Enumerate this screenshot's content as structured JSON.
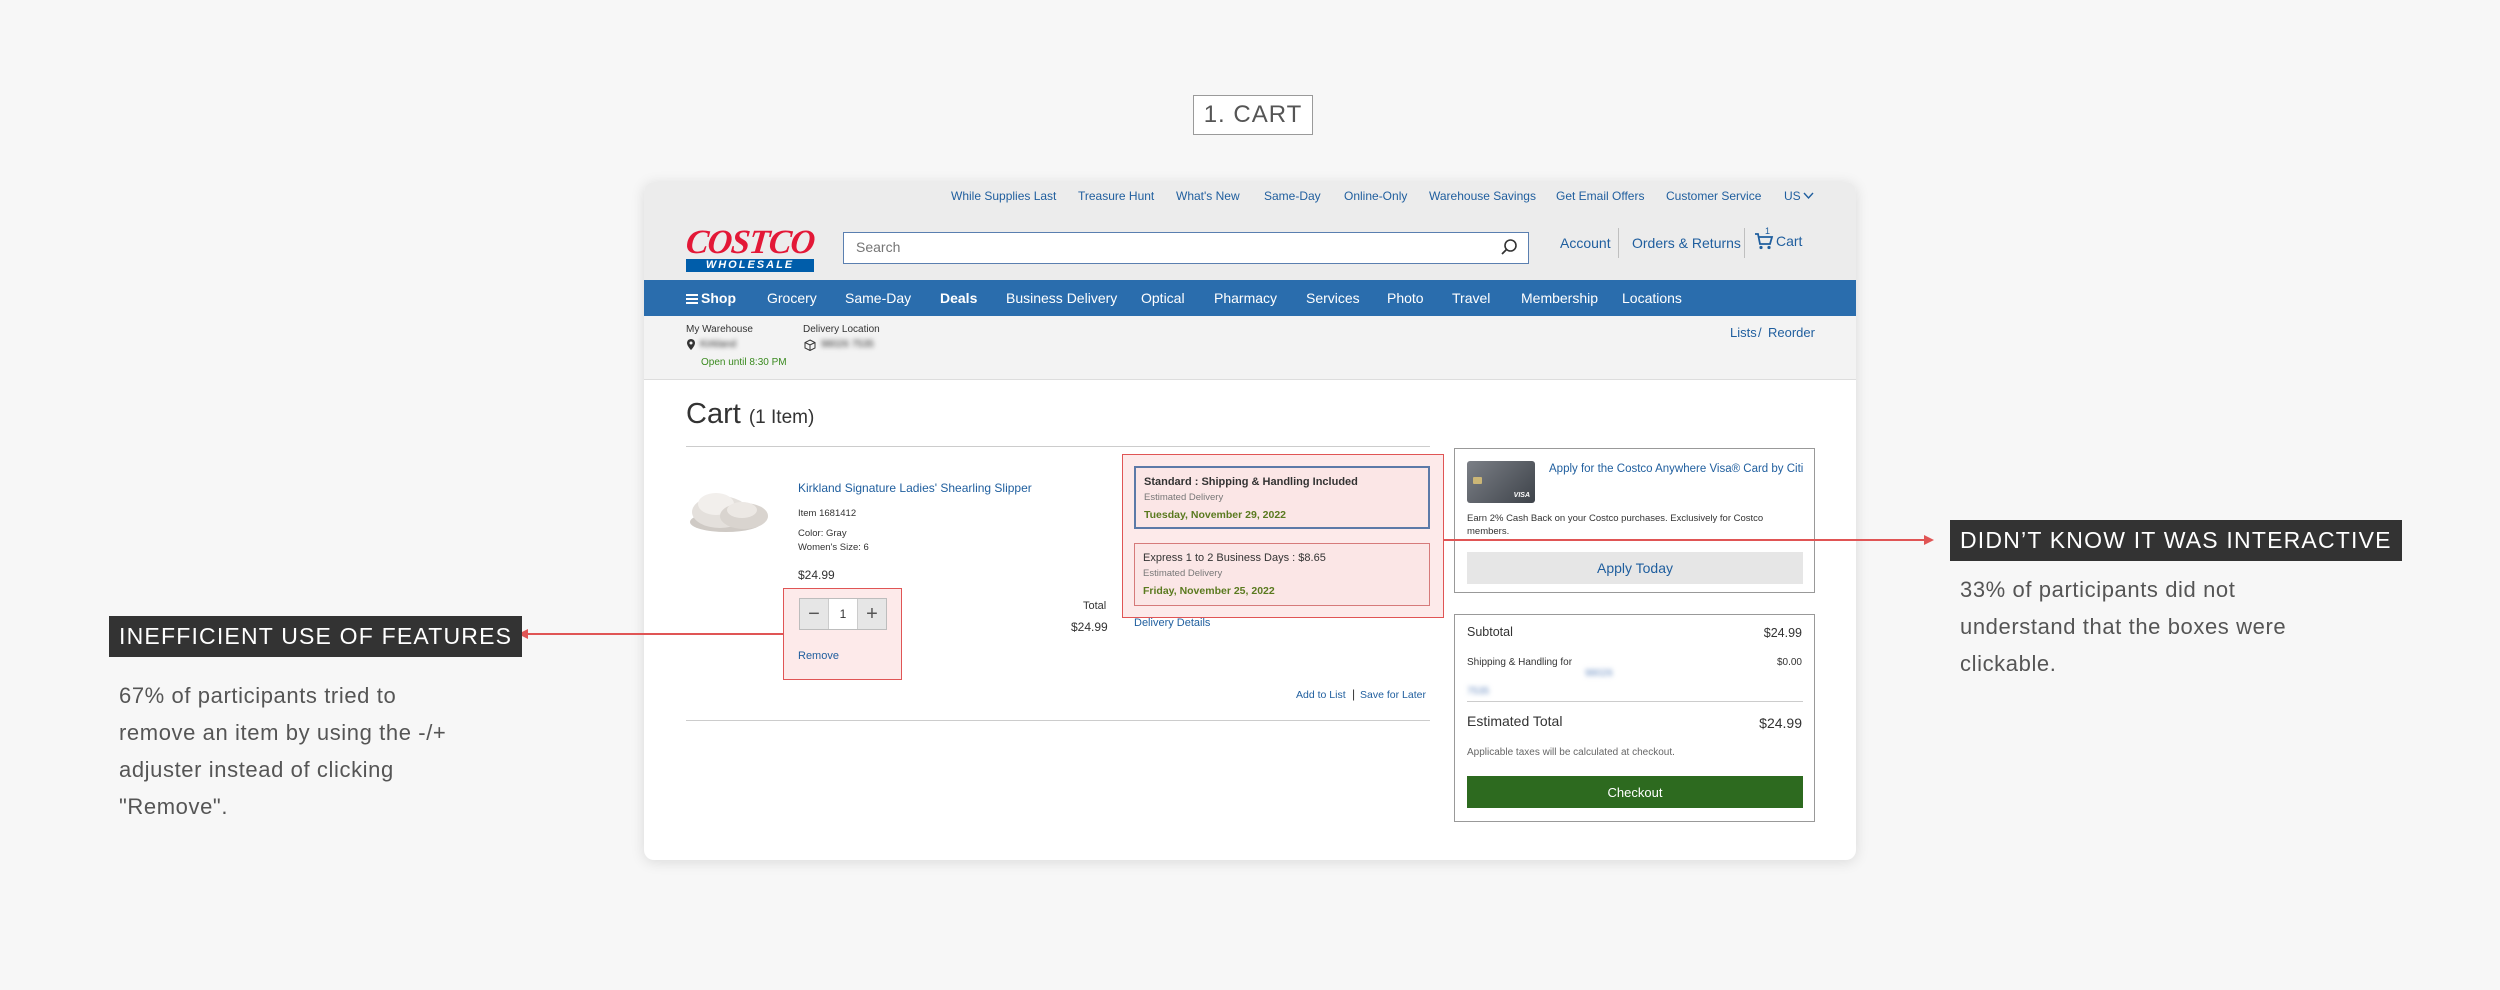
{
  "step_label": "1. CART",
  "util_links": [
    "While Supplies Last",
    "Treasure Hunt",
    "What's New",
    "Same-Day",
    "Online-Only",
    "Warehouse Savings",
    "Get Email Offers",
    "Customer Service",
    "US"
  ],
  "logo": {
    "top": "COSTCO",
    "bottom": "WHOLESALE"
  },
  "search": {
    "placeholder": "Search"
  },
  "header_links": {
    "account": "Account",
    "orders": "Orders & Returns",
    "cart": "Cart",
    "cart_count": "1"
  },
  "nav": {
    "shop": "Shop",
    "items": [
      "Grocery",
      "Same-Day",
      "Deals",
      "Business Delivery",
      "Optical",
      "Pharmacy",
      "Services",
      "Photo",
      "Travel",
      "Membership",
      "Locations"
    ]
  },
  "location": {
    "warehouse_label": "My Warehouse",
    "warehouse_name": "Kirkland",
    "open_until": "Open until 8:30 PM",
    "delivery_label": "Delivery Location",
    "delivery_zip": "98026 7535",
    "lists": "Lists",
    "reorder": "Reorder"
  },
  "cart": {
    "title": "Cart",
    "count": "(1 Item)",
    "item": {
      "name": "Kirkland Signature Ladies' Shearling Slipper",
      "item_no": "Item 1681412",
      "color": "Color: Gray",
      "size": "Women's Size: 6",
      "price": "$24.99",
      "qty": "1",
      "remove": "Remove",
      "total_label": "Total",
      "total": "$24.99"
    },
    "shipping": [
      {
        "title": "Standard : Shipping & Handling Included",
        "sub": "Estimated Delivery",
        "date": "Tuesday, November 29, 2022"
      },
      {
        "title": "Express 1 to 2 Business Days : $8.65",
        "sub": "Estimated Delivery",
        "date": "Friday, November 25, 2022"
      }
    ],
    "delivery_details": "Delivery Details",
    "add_to_list": "Add to List",
    "save_for_later": "Save for Later"
  },
  "promo": {
    "title": "Apply for the Costco Anywhere Visa® Card by Citi",
    "desc": "Earn 2% Cash Back on your Costco purchases. Exclusively for Costco members.",
    "button": "Apply Today"
  },
  "summary": {
    "subtotal_label": "Subtotal",
    "subtotal": "$24.99",
    "shipping_label": "Shipping & Handling for",
    "shipping_zip": "98026 7535",
    "shipping": "$0.00",
    "estimated_label": "Estimated Total",
    "estimated": "$24.99",
    "tax_note": "Applicable taxes will be calculated at checkout.",
    "checkout": "Checkout"
  },
  "callouts": {
    "left": {
      "tag": "INEFFICIENT USE OF FEATURES",
      "body": [
        "67% of participants tried to",
        "remove an item by using the -/+",
        "adjuster instead of clicking",
        "\"Remove\"."
      ]
    },
    "right": {
      "tag": "DIDN’T KNOW IT WAS INTERACTIVE",
      "body": [
        "33% of participants did not",
        "understand that the boxes were",
        "clickable."
      ]
    }
  },
  "colors": {
    "nav": "#2a6dad",
    "link": "#1f5e9e",
    "logo_red": "#e31837",
    "highlight": "#e05555",
    "checkout": "#2d6a1f",
    "tag_bg": "#333333"
  }
}
